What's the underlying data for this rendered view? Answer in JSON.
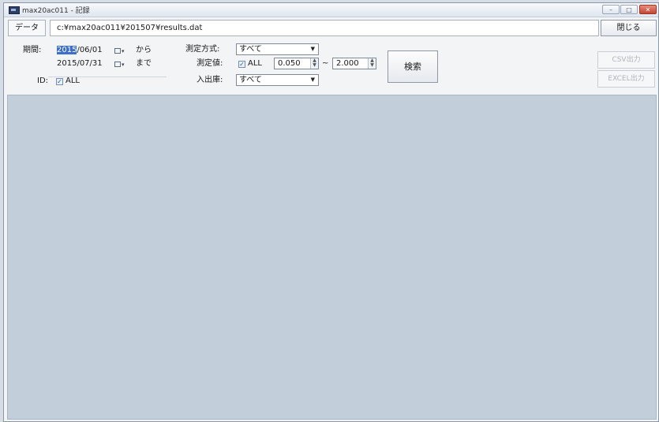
{
  "window": {
    "title": "max20ac011 - 記録",
    "controls": {
      "minimize": "–",
      "maximize": "□",
      "close": "✕"
    }
  },
  "data_row": {
    "label": "データ",
    "path": "c:¥max20ac011¥201507¥results.dat",
    "close_button": "閉じる"
  },
  "filters": {
    "period_label": "期間:",
    "start_date_year": "2015",
    "start_date_rest": "/06/01",
    "from_label": "から",
    "end_date": "2015/07/31",
    "to_label": "まで",
    "id_label": "ID:",
    "id_all_label": "ALL",
    "method_label": "測定方式:",
    "method_value": "すべて",
    "value_label": "測定値:",
    "value_all_label": "ALL",
    "value_min": "0.050",
    "range_sep": "~",
    "value_max": "2.000",
    "inout_label": "入出庫:",
    "inout_value": "すべて"
  },
  "buttons": {
    "search": "検索",
    "csv_export": "CSV出力",
    "excel_export": "EXCEL出力"
  }
}
